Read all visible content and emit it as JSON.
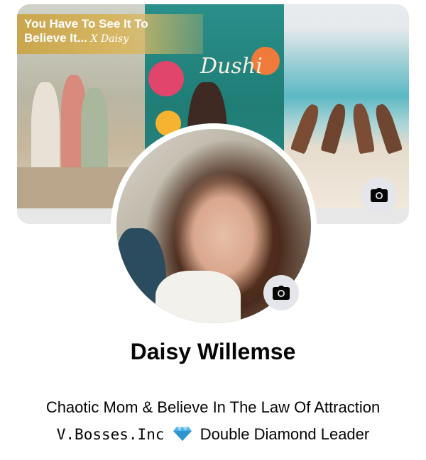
{
  "cover": {
    "banner_text": "You Have To See It To Believe It...",
    "banner_signature": "X Daisy",
    "dushi_title": "Dushi",
    "camera_icon": "camera-icon"
  },
  "profile": {
    "name": "Daisy Willemse",
    "camera_icon": "camera-icon"
  },
  "bio": {
    "line1": "Chaotic Mom & Believe In The Law Of Attraction",
    "line2_prefix": "V.Bosses.Inc",
    "line2_icon": "diamond-icon",
    "line2_suffix": "Double Diamond Leader"
  },
  "colors": {
    "background": "#ffffff",
    "text": "#050505",
    "camera_button": "#e4e6eb",
    "banner_gold": "#c9a64d",
    "diamond": "#4fb3e8"
  }
}
